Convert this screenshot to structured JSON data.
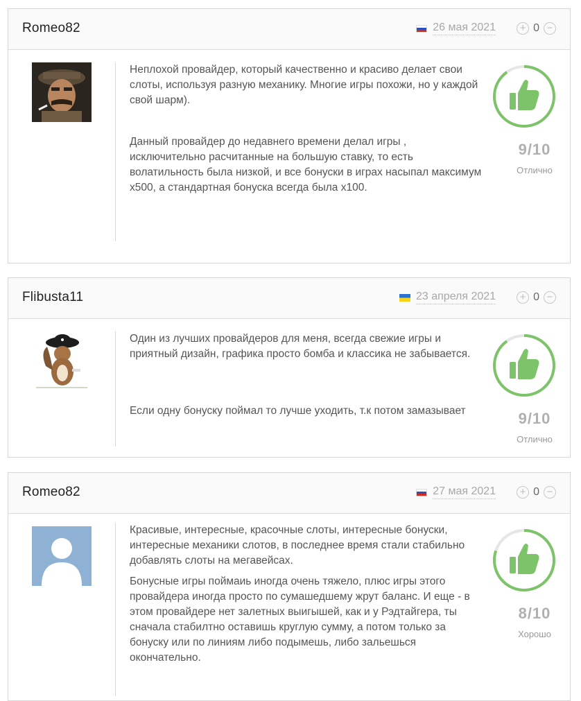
{
  "reviews": [
    {
      "author": "Romeo82",
      "flag": "ru",
      "date": "26 мая 2021",
      "plus": "+",
      "minus": "−",
      "votes": "0",
      "paragraphs": [
        "Неплохой провайдер, который качественно и красиво делает свои слоты, используя разную механику. Многие игры похожи, но у каждой свой шарм).",
        "Данный провайдер до недавнего времени делал игры , исключительно расчитанные на большую ставку, то есть волатильность была низкой, и все бонуски в играх насыпал максимум х500, а стандартная бонуска всегда была х100."
      ],
      "score": "9/10",
      "score_label": "Отлично",
      "rating_fraction": 0.9
    },
    {
      "author": "Flibusta11",
      "flag": "ua",
      "date": "23 апреля 2021",
      "plus": "+",
      "minus": "−",
      "votes": "0",
      "paragraphs": [
        "Один из лучших провайдеров для меня, всегда свежие игры и приятный дизайн, графика просто бомба и классика не забывается.",
        "Если одну бонуску поймал то лучше уходить, т.к потом замазывает"
      ],
      "score": "9/10",
      "score_label": "Отлично",
      "rating_fraction": 0.9
    },
    {
      "author": "Romeo82",
      "flag": "ru",
      "date": "27 мая 2021",
      "plus": "+",
      "minus": "−",
      "votes": "0",
      "paragraphs": [
        "Красивые, интересные, красочные слоты, интересные бонуски, интересные механики слотов, в последнее время стали стабильно добавлять слоты на мегавейсах.",
        "Бонусные игры поймаиь иногда очень тяжело, плюс игры этого провайдера иногда просто по сумашедшему жрут баланс. И еще - в этом провайдере нет залетных выигышей, как и у Рэдтайгера, ты сначала стабилтно оставишь круглую сумму, а потом только за бонуску или по линиям либо подымешь, либо зальешься окончательно."
      ],
      "score": "8/10",
      "score_label": "Хорошо",
      "rating_fraction": 0.8
    }
  ],
  "colors": {
    "accent_green": "#7dc36a",
    "ring_track": "#e6e6e6",
    "muted_text": "#a8a8a8"
  },
  "icons": {
    "vote_up": "plus-circle-icon",
    "vote_down": "minus-circle-icon",
    "rating": "thumbs-up-icon"
  }
}
